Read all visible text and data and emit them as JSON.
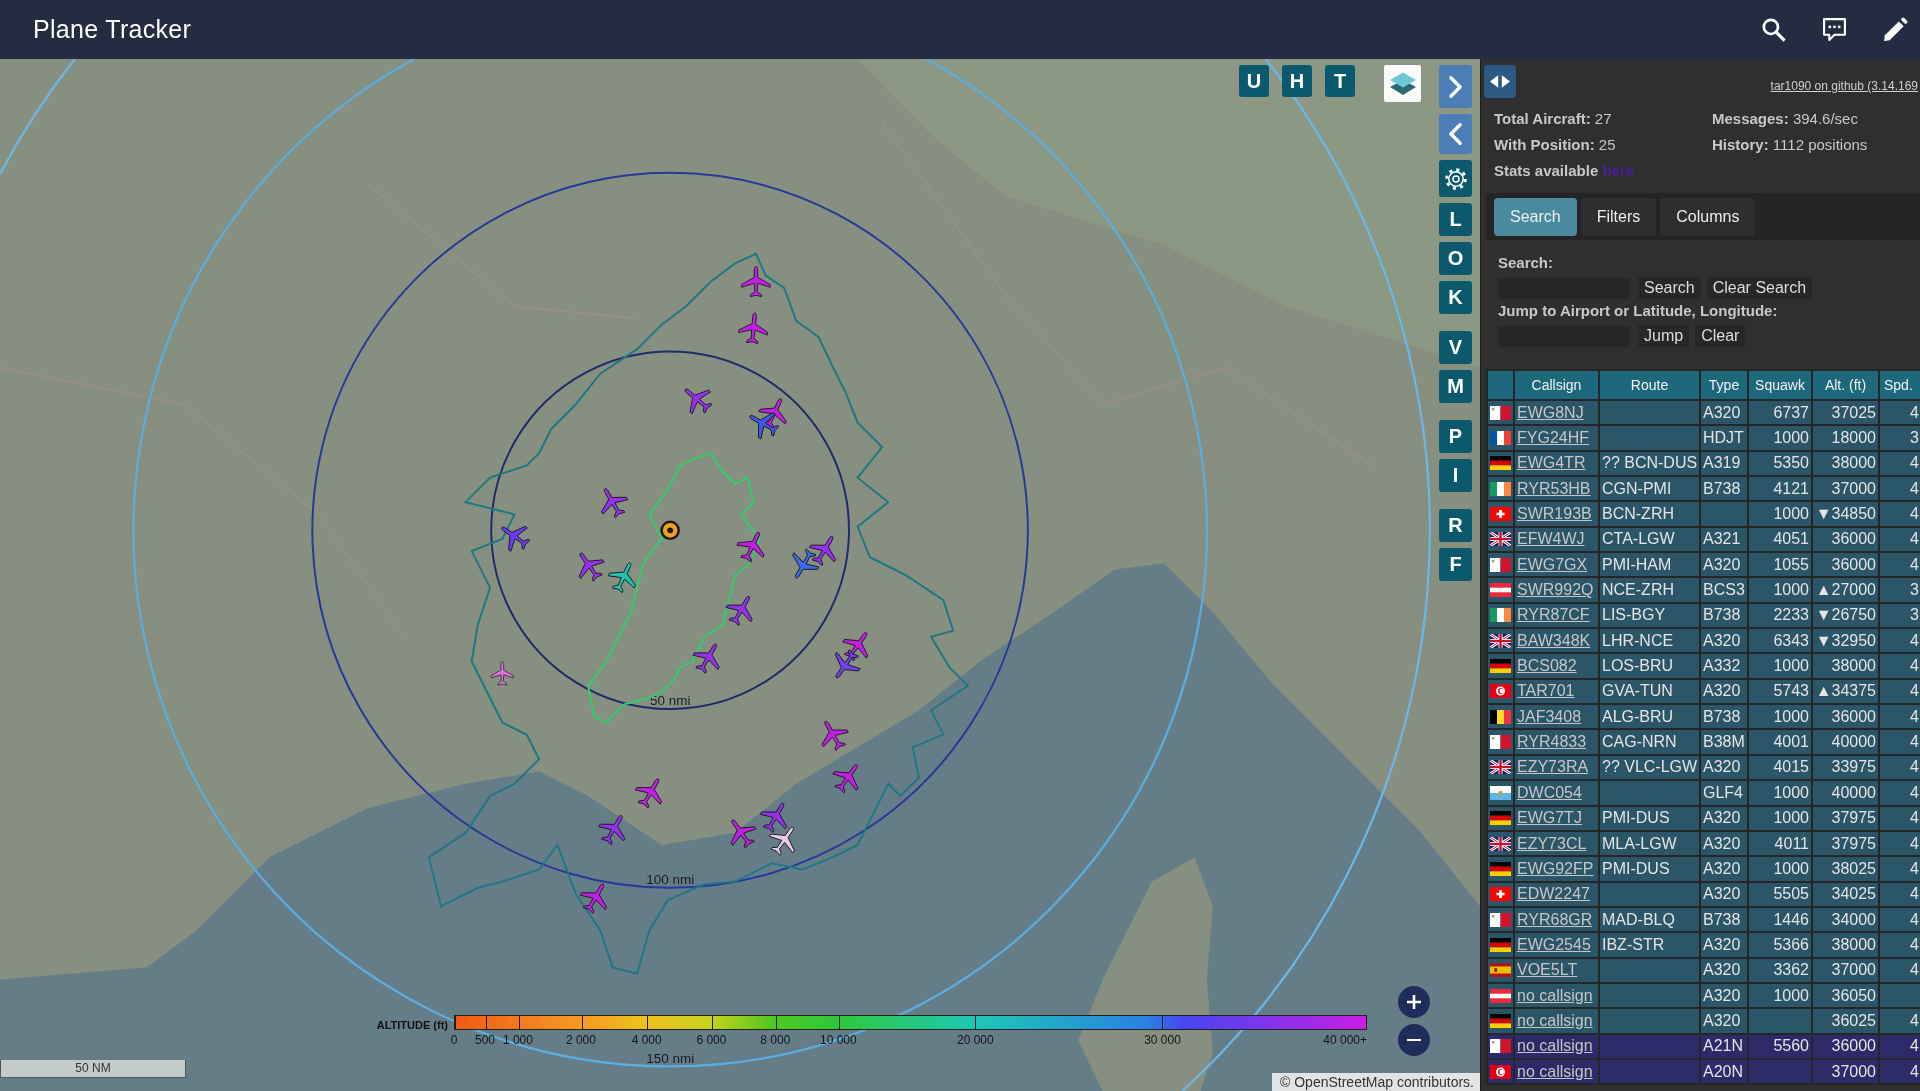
{
  "header": {
    "title": "Plane Tracker",
    "icons": [
      {
        "kind": "search"
      },
      {
        "kind": "chat"
      },
      {
        "kind": "edit"
      }
    ]
  },
  "map": {
    "controls_top": [
      {
        "kind": "letter",
        "label": "U"
      },
      {
        "kind": "letter",
        "label": "H"
      },
      {
        "kind": "letter",
        "label": "T"
      },
      {
        "kind": "layers"
      }
    ],
    "controls_side": [
      [
        {
          "kind": "next"
        },
        {
          "kind": "previous"
        },
        {
          "kind": "settings"
        },
        {
          "kind": "letter",
          "label": "L"
        },
        {
          "kind": "letter",
          "label": "O"
        },
        {
          "kind": "letter",
          "label": "K"
        }
      ],
      [
        {
          "kind": "letter",
          "label": "V"
        },
        {
          "kind": "letter",
          "label": "M"
        }
      ],
      [
        {
          "kind": "letter",
          "label": "P"
        },
        {
          "kind": "letter",
          "label": "I"
        }
      ],
      [
        {
          "kind": "letter",
          "label": "R"
        },
        {
          "kind": "letter",
          "label": "F"
        }
      ]
    ],
    "range_rings": [
      {
        "label": "50 nmi",
        "color": "#1d2b6b"
      },
      {
        "label": "100 nmi",
        "color": "#24399a"
      },
      {
        "label": "150 nmi",
        "color": "#5aaee0"
      },
      {
        "color": "#6ab8e8"
      }
    ],
    "aircraft": [
      {
        "color": "#c21ee6"
      },
      {
        "color": "#c21ee6"
      },
      {
        "color": "#9630ee"
      },
      {
        "color": "#c21ee6"
      },
      {
        "color": "#3c5ae8"
      },
      {
        "color": "#9630ee"
      },
      {
        "color": "#6a3cee"
      },
      {
        "color": "#9630ee"
      },
      {
        "color": "#22c4b0"
      },
      {
        "color": "#c21ee6"
      },
      {
        "color": "#9630ee"
      },
      {
        "color": "#3c6ae8"
      },
      {
        "color": "#9630ee"
      },
      {
        "color": "#9630ee"
      },
      {
        "color": "#c21ee6"
      },
      {
        "color": "#7040ee"
      },
      {
        "color": "#e070e0"
      },
      {
        "color": "#c21ee6"
      },
      {
        "color": "#c21ee6"
      },
      {
        "color": "#c21ee6"
      },
      {
        "color": "#9630ee"
      },
      {
        "color": "#c21ee6"
      },
      {
        "color": "#9630ee"
      },
      {
        "color": "#e8c8e8"
      },
      {
        "color": "#c21ee6"
      }
    ],
    "altitude_legend": {
      "title": "ALTITUDE (ft)",
      "ticks": [
        "0",
        "500",
        "1 000",
        "2 000",
        "4 000",
        "6 000",
        "8 000",
        "10 000",
        "20 000",
        "30 000",
        "40 000+"
      ]
    },
    "scale_bar": "50 NM",
    "zoom_buttons": [
      {
        "kind": "in"
      },
      {
        "kind": "out"
      }
    ],
    "attribution": {
      "prefix": "©",
      "link": "OpenStreetMap",
      "suffix": "contributors."
    }
  },
  "panel": {
    "github_link": "tar1090 on github (3.14.169",
    "stats": [
      {
        "text": "**Total Aircraft:** 27"
      },
      {
        "text": "**Messages:** 394.6/sec"
      },
      {
        "text": "**With Position:** 25"
      },
      {
        "text": "**History:** 1112 positions"
      }
    ],
    "stats_note": {
      "text": "Stats available",
      "link": "here"
    },
    "tabs": [
      {
        "label": "Search",
        "selected": true
      },
      {
        "label": "Filters",
        "selected": false
      },
      {
        "label": "Columns",
        "selected": false
      }
    ],
    "search": {
      "label": "Search:",
      "buttons": [
        "Search",
        "Clear Search"
      ]
    },
    "jump": {
      "label": "Jump to Airport or Latitude, Longitude:",
      "buttons": [
        "Jump",
        "Clear"
      ]
    },
    "table": {
      "columns": [
        "Callsign",
        "Route",
        "Type",
        "Squawk",
        "Alt. (ft)",
        "Spd."
      ],
      "rows": [
        {
          "flag": {
            "kind": "malta"
          },
          "callsign": "EWG8NJ",
          "type": "A320",
          "squawk": "6737",
          "altitude": "37025",
          "speed": "4",
          "highlighted": false
        },
        {
          "flag": {
            "kind": "france"
          },
          "callsign": "FYG24HF",
          "type": "HDJT",
          "squawk": "1000",
          "altitude": "18000",
          "speed": "3",
          "highlighted": false
        },
        {
          "flag": {
            "kind": "germany"
          },
          "callsign": "EWG4TR",
          "route": "?? BCN-DUS",
          "type": "A319",
          "squawk": "5350",
          "altitude": "38000",
          "speed": "4",
          "highlighted": false
        },
        {
          "flag": {
            "kind": "ireland"
          },
          "callsign": "RYR53HB",
          "route": "CGN-PMI",
          "type": "B738",
          "squawk": "4121",
          "altitude": "37000",
          "speed": "4",
          "highlighted": false
        },
        {
          "flag": {
            "kind": "switzerland"
          },
          "callsign": "SWR193B",
          "route": "BCN-ZRH",
          "squawk": "1000",
          "altitude": "▼34850",
          "speed": "4",
          "highlighted": false
        },
        {
          "flag": {
            "kind": "uk"
          },
          "callsign": "EFW4WJ",
          "route": "CTA-LGW",
          "type": "A321",
          "squawk": "4051",
          "altitude": "36000",
          "speed": "4",
          "highlighted": false
        },
        {
          "flag": {
            "kind": "malta"
          },
          "callsign": "EWG7GX",
          "route": "PMI-HAM",
          "type": "A320",
          "squawk": "1055",
          "altitude": "36000",
          "speed": "4",
          "highlighted": false
        },
        {
          "flag": {
            "kind": "austria"
          },
          "callsign": "SWR992Q",
          "route": "NCE-ZRH",
          "type": "BCS3",
          "squawk": "1000",
          "altitude": "▲27000",
          "speed": "3",
          "highlighted": false
        },
        {
          "flag": {
            "kind": "ireland"
          },
          "callsign": "RYR87CF",
          "route": "LIS-BGY",
          "type": "B738",
          "squawk": "2233",
          "altitude": "▼26750",
          "speed": "3",
          "highlighted": false
        },
        {
          "flag": {
            "kind": "uk"
          },
          "callsign": "BAW348K",
          "route": "LHR-NCE",
          "type": "A320",
          "squawk": "6343",
          "altitude": "▼32950",
          "speed": "4",
          "highlighted": false
        },
        {
          "flag": {
            "kind": "germany"
          },
          "callsign": "BCS082",
          "route": "LOS-BRU",
          "type": "A332",
          "squawk": "1000",
          "altitude": "38000",
          "speed": "4",
          "highlighted": false
        },
        {
          "flag": {
            "kind": "tunisia"
          },
          "callsign": "TAR701",
          "route": "GVA-TUN",
          "type": "A320",
          "squawk": "5743",
          "altitude": "▲34375",
          "speed": "4",
          "highlighted": false
        },
        {
          "flag": {
            "kind": "belgium"
          },
          "callsign": "JAF3408",
          "route": "ALG-BRU",
          "type": "B738",
          "squawk": "1000",
          "altitude": "36000",
          "speed": "4",
          "highlighted": false
        },
        {
          "flag": {
            "kind": "malta"
          },
          "callsign": "RYR4833",
          "route": "CAG-NRN",
          "type": "B38M",
          "squawk": "4001",
          "altitude": "40000",
          "speed": "4",
          "highlighted": false
        },
        {
          "flag": {
            "kind": "uk"
          },
          "callsign": "EZY73RA",
          "route": "?? VLC-LGW",
          "type": "A320",
          "squawk": "4015",
          "altitude": "33975",
          "speed": "4",
          "highlighted": false
        },
        {
          "flag": {
            "kind": "sanmarino"
          },
          "callsign": "DWC054",
          "type": "GLF4",
          "squawk": "1000",
          "altitude": "40000",
          "speed": "4",
          "highlighted": false
        },
        {
          "flag": {
            "kind": "germany"
          },
          "callsign": "EWG7TJ",
          "route": "PMI-DUS",
          "type": "A320",
          "squawk": "1000",
          "altitude": "37975",
          "speed": "4",
          "highlighted": false
        },
        {
          "flag": {
            "kind": "uk"
          },
          "callsign": "EZY73CL",
          "route": "MLA-LGW",
          "type": "A320",
          "squawk": "4011",
          "altitude": "37975",
          "speed": "4",
          "highlighted": false
        },
        {
          "flag": {
            "kind": "germany"
          },
          "callsign": "EWG92FP",
          "route": "PMI-DUS",
          "type": "A320",
          "squawk": "1000",
          "altitude": "38025",
          "speed": "4",
          "highlighted": false
        },
        {
          "flag": {
            "kind": "switzerland"
          },
          "callsign": "EDW2247",
          "type": "A320",
          "squawk": "5505",
          "altitude": "34025",
          "speed": "4",
          "highlighted": false
        },
        {
          "flag": {
            "kind": "malta"
          },
          "callsign": "RYR68GR",
          "route": "MAD-BLQ",
          "type": "B738",
          "squawk": "1446",
          "altitude": "34000",
          "speed": "4",
          "highlighted": false
        },
        {
          "flag": {
            "kind": "germany"
          },
          "callsign": "EWG2545",
          "route": "IBZ-STR",
          "type": "A320",
          "squawk": "5366",
          "altitude": "38000",
          "speed": "4",
          "highlighted": false
        },
        {
          "flag": {
            "kind": "spain"
          },
          "callsign": "VOE5LT",
          "type": "A320",
          "squawk": "3362",
          "altitude": "37000",
          "speed": "4",
          "highlighted": false
        },
        {
          "flag": {
            "kind": "austria"
          },
          "callsign": "no callsign",
          "type": "A320",
          "squawk": "1000",
          "altitude": "36050",
          "highlighted": false
        },
        {
          "flag": {
            "kind": "germany"
          },
          "callsign": "no callsign",
          "type": "A320",
          "altitude": "36025",
          "speed": "4",
          "highlighted": false
        },
        {
          "flag": {
            "kind": "malta"
          },
          "callsign": "no callsign",
          "type": "A21N",
          "squawk": "5560",
          "altitude": "36000",
          "speed": "4",
          "highlighted": true
        },
        {
          "flag": {
            "kind": "tunisia"
          },
          "callsign": "no callsign",
          "type": "A20N",
          "altitude": "37000",
          "speed": "4",
          "highlighted": true
        }
      ]
    }
  }
}
